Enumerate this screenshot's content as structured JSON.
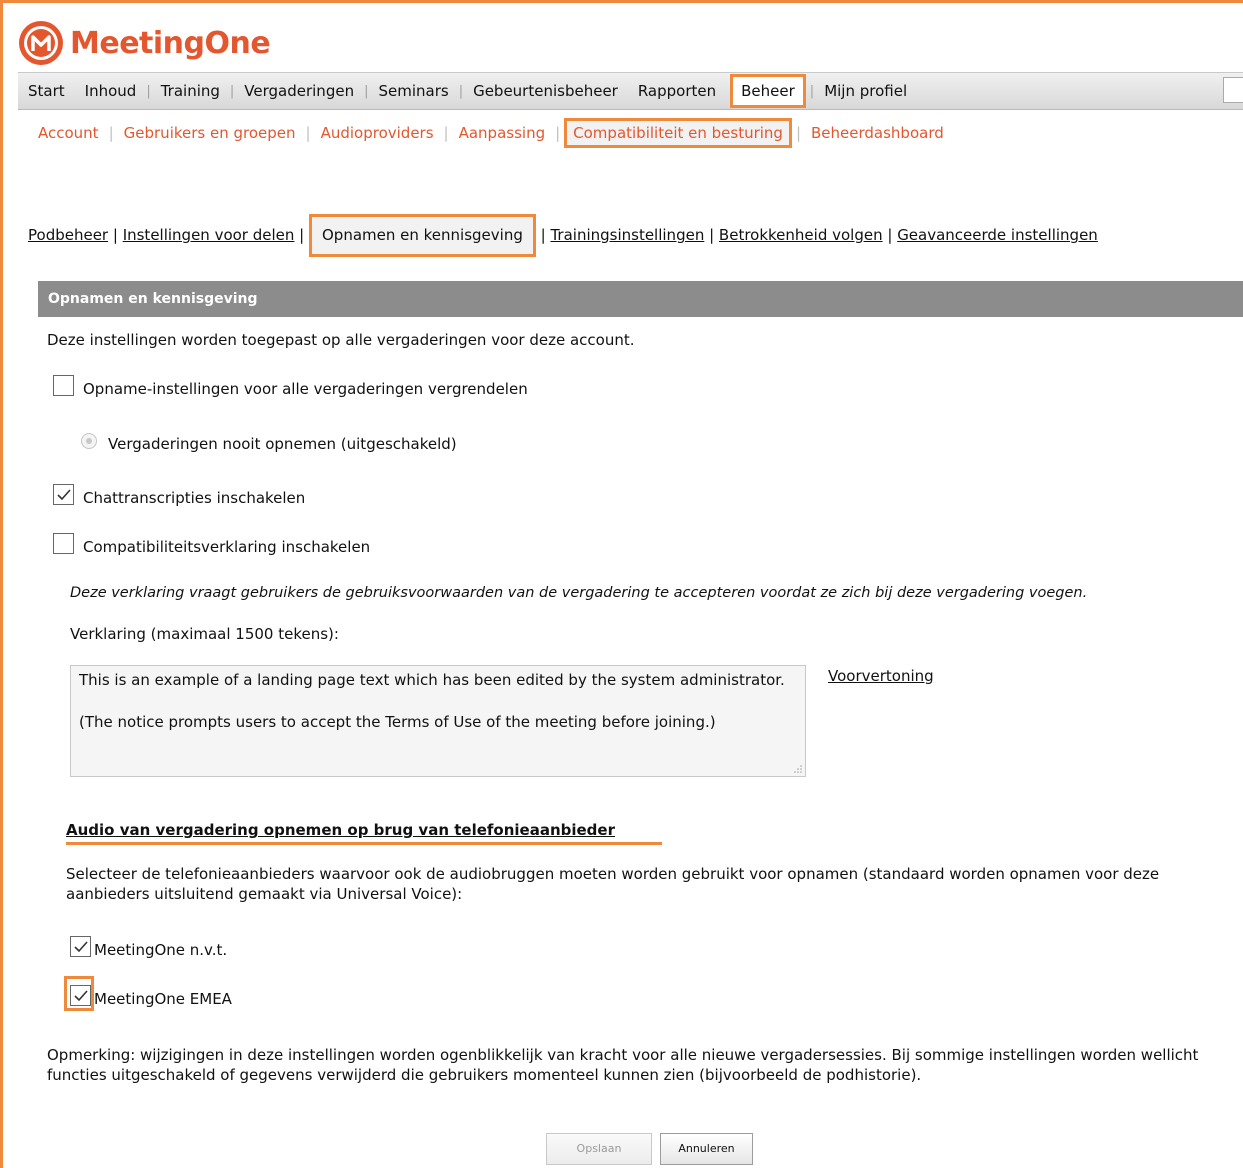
{
  "brand": {
    "name": "MeetingOne",
    "accent": "#e4572e",
    "highlight": "#ef8a3c"
  },
  "mainnav": [
    {
      "label": "Start"
    },
    {
      "label": "Inhoud"
    },
    {
      "label": "Training"
    },
    {
      "label": "Vergaderingen"
    },
    {
      "label": "Seminars"
    },
    {
      "label": "Gebeurtenisbeheer"
    },
    {
      "label": "Rapporten"
    },
    {
      "label": "Beheer"
    },
    {
      "label": "Mijn profiel"
    }
  ],
  "subnav": [
    {
      "label": "Account"
    },
    {
      "label": "Gebruikers en groepen"
    },
    {
      "label": "Audioproviders"
    },
    {
      "label": "Aanpassing"
    },
    {
      "label": "Compatibiliteit en besturing"
    },
    {
      "label": "Beheerdashboard"
    }
  ],
  "pagelinks": {
    "podbeheer": "Podbeheer",
    "delen": "Instellingen voor delen",
    "opnamen": "Opnamen en kennisgeving",
    "training": "Trainingsinstellingen",
    "betrokkenheid": "Betrokkenheid volgen",
    "geavanceerd": "Geavanceerde instellingen"
  },
  "section": {
    "title": "Opnamen en kennisgeving",
    "intro": "Deze instellingen worden toegepast op alle vergaderingen voor deze account."
  },
  "options": {
    "lock_recording": {
      "label": "Opname-instellingen voor alle vergaderingen vergrendelen",
      "checked": false
    },
    "never_record": {
      "label": "Vergaderingen nooit opnemen (uitgeschakeld)"
    },
    "chat_transcripts": {
      "label": "Chattranscripties inschakelen",
      "checked": true
    },
    "compat_notice": {
      "label": "Compatibiliteitsverklaring inschakelen",
      "checked": false
    }
  },
  "notice": {
    "description": "Deze verklaring vraagt gebruikers de gebruiksvoorwaarden van de vergadering te accepteren voordat ze zich bij deze vergadering voegen.",
    "label": "Verklaring (maximaal 1500 tekens):",
    "text": "This is an example of a landing page text which has been edited by the system administrator.\n\n(The notice prompts users to accept the Terms of Use of the meeting before joining.)",
    "preview": "Voorvertoning"
  },
  "audio": {
    "heading": "Audio van vergadering opnemen op brug van telefonieaanbieder",
    "description": "Selecteer de telefonieaanbieders waarvoor ook de audiobruggen moeten worden gebruikt voor opnamen (standaard worden opnamen voor deze aanbieders uitsluitend gemaakt via Universal Voice):",
    "providers": [
      {
        "label": "MeetingOne n.v.t.",
        "checked": true
      },
      {
        "label": "MeetingOne EMEA",
        "checked": true
      }
    ]
  },
  "footer_note": "Opmerking: wijzigingen in deze instellingen worden ogenblikkelijk van kracht voor alle nieuwe vergadersessies. Bij sommige instellingen worden wellicht functies uitgeschakeld of gegevens verwijderd die gebruikers momenteel kunnen zien (bijvoorbeeld de podhistorie).",
  "buttons": {
    "save": "Opslaan",
    "cancel": "Annuleren"
  }
}
